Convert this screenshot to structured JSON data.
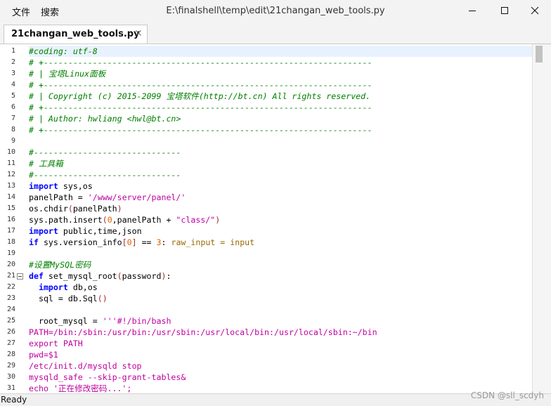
{
  "menu": {
    "file": "文件",
    "search": "搜索"
  },
  "window": {
    "title": "E:\\finalshell\\temp\\edit\\21changan_web_tools.py"
  },
  "tab": {
    "label": "21changan_web_tools.py"
  },
  "editor": {
    "lines": [
      [
        [
          "cm",
          "#coding: utf-8"
        ]
      ],
      [
        [
          "cm",
          "# +-------------------------------------------------------------------"
        ]
      ],
      [
        [
          "cm",
          "# | 宝塔Linux面板"
        ]
      ],
      [
        [
          "cm",
          "# +-------------------------------------------------------------------"
        ]
      ],
      [
        [
          "cm",
          "# | Copyright (c) 2015-2099 宝塔软件(http://bt.cn) All rights reserved."
        ]
      ],
      [
        [
          "cm",
          "# +-------------------------------------------------------------------"
        ]
      ],
      [
        [
          "cm",
          "# | Author: hwliang <hwl@bt.cn>"
        ]
      ],
      [
        [
          "cm",
          "# +-------------------------------------------------------------------"
        ]
      ],
      [],
      [
        [
          "cm",
          "#------------------------------"
        ]
      ],
      [
        [
          "cm",
          "# 工具箱"
        ]
      ],
      [
        [
          "cm",
          "#------------------------------"
        ]
      ],
      [
        [
          "kw",
          "import"
        ],
        [
          "",
          "  sys,os"
        ]
      ],
      [
        [
          "",
          "panelPath = "
        ],
        [
          "st",
          "'/www/server/panel/'"
        ]
      ],
      [
        [
          "",
          "os.chdir"
        ],
        [
          "op",
          "("
        ],
        [
          "",
          "panelPath"
        ],
        [
          "op",
          ")"
        ]
      ],
      [
        [
          "",
          "sys.path.insert"
        ],
        [
          "op",
          "("
        ],
        [
          "nu",
          "0"
        ],
        [
          "",
          ",panelPath + "
        ],
        [
          "st",
          "\"class/\""
        ],
        [
          "op",
          ")"
        ]
      ],
      [
        [
          "kw",
          "import"
        ],
        [
          "",
          "  public,time,json"
        ]
      ],
      [
        [
          "kw",
          "if"
        ],
        [
          "",
          "  sys.version_info"
        ],
        [
          "op",
          "["
        ],
        [
          "nu",
          "0"
        ],
        [
          "op",
          "]"
        ],
        [
          "",
          "  == "
        ],
        [
          "nu",
          "3"
        ],
        [
          "",
          ": "
        ],
        [
          "bi",
          "raw_input"
        ],
        [
          "",
          ""
        ],
        [
          "bi",
          " = input"
        ]
      ],
      [],
      [
        [
          "cm",
          "#设置MySQL密码"
        ]
      ],
      [
        [
          "kw",
          "def"
        ],
        [
          "",
          ""
        ],
        [
          "",
          "  set_mysql_root"
        ],
        [
          "op",
          "("
        ],
        [
          "",
          "password"
        ],
        [
          "op",
          ")"
        ],
        [
          "",
          ":"
        ]
      ],
      [
        [
          "",
          "    "
        ],
        [
          "kw",
          "import"
        ],
        [
          "",
          "  db,os"
        ]
      ],
      [
        [
          "",
          "    sql = db.Sql"
        ],
        [
          "op",
          "()"
        ]
      ],
      [],
      [
        [
          "",
          "    root_mysql = "
        ],
        [
          "st",
          "'''#!/bin/bash"
        ]
      ],
      [
        [
          "st",
          "PATH=/bin:/sbin:/usr/bin:/usr/sbin:/usr/local/bin:/usr/local/sbin:~/bin"
        ]
      ],
      [
        [
          "st",
          "export PATH"
        ]
      ],
      [
        [
          "st",
          "pwd=$1"
        ]
      ],
      [
        [
          "st",
          "/etc/init.d/mysqld stop"
        ]
      ],
      [
        [
          "st",
          "mysqld_safe --skip-grant-tables&"
        ]
      ],
      [
        [
          "st",
          "echo '正在修改密码...';"
        ]
      ]
    ]
  },
  "status": {
    "text": "Ready"
  },
  "watermark": "CSDN @sll_scdyh",
  "colors": {
    "comment": "#008000",
    "keyword": "#0000ff",
    "string": "#c000a0",
    "number": "#e06000",
    "active_line": "#e8f2fe"
  },
  "icons": [
    "minimize-icon",
    "maximize-icon",
    "close-icon",
    "tab-close-icon",
    "fold-collapse-icon"
  ]
}
